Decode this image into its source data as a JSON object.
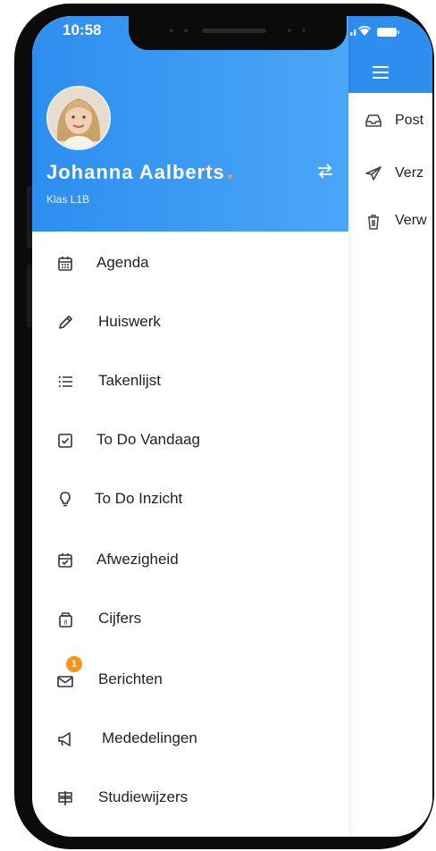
{
  "status_bar": {
    "time": "10:58"
  },
  "profile": {
    "name": "Johanna  Aalberts",
    "class": "Klas L1B"
  },
  "menu": [
    {
      "label": "Agenda",
      "icon": "calendar-icon"
    },
    {
      "label": "Huiswerk",
      "icon": "pencil-icon"
    },
    {
      "label": "Takenlijst",
      "icon": "list-icon"
    },
    {
      "label": "To Do Vandaag",
      "icon": "checkbox-icon"
    },
    {
      "label": "To Do Inzicht",
      "icon": "lightbulb-icon"
    },
    {
      "label": "Afwezigheid",
      "icon": "calendar-check-icon"
    },
    {
      "label": "Cijfers",
      "icon": "grades-icon"
    },
    {
      "label": "Berichten",
      "icon": "mail-icon",
      "badge": "1"
    },
    {
      "label": "Mededelingen",
      "icon": "megaphone-icon"
    },
    {
      "label": "Studiewijzers",
      "icon": "signpost-icon"
    }
  ],
  "background_app": {
    "items": [
      {
        "label": "Post",
        "icon": "inbox-icon"
      },
      {
        "label": "Verz",
        "icon": "send-icon"
      },
      {
        "label": "Verw",
        "icon": "trash-icon"
      }
    ]
  },
  "colors": {
    "header_blue": "#2e8ef0",
    "badge_orange": "#f7941d",
    "accent_dot": "#f39a2c"
  }
}
